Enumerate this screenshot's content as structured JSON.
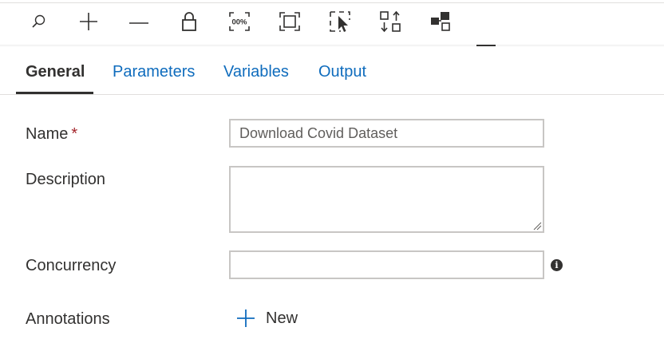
{
  "toolbar": {
    "tools": [
      {
        "icon": "search-icon"
      },
      {
        "icon": "plus-icon"
      },
      {
        "icon": "minus-icon"
      },
      {
        "icon": "lock-icon"
      },
      {
        "icon": "zoom-100-icon",
        "text": "00%"
      },
      {
        "icon": "fit-to-screen-icon"
      },
      {
        "icon": "select-icon"
      },
      {
        "icon": "auto-align-icon"
      },
      {
        "icon": "layout-icon"
      }
    ]
  },
  "tabs": [
    {
      "label": "General",
      "active": true
    },
    {
      "label": "Parameters",
      "active": false
    },
    {
      "label": "Variables",
      "active": false
    },
    {
      "label": "Output",
      "active": false
    }
  ],
  "form": {
    "name": {
      "label": "Name",
      "required_mark": "*",
      "value": "Download Covid Dataset"
    },
    "description": {
      "label": "Description",
      "value": ""
    },
    "concurrency": {
      "label": "Concurrency",
      "value": "",
      "info_icon": "i"
    },
    "annotations": {
      "label": "Annotations",
      "new_label": "New"
    }
  },
  "colors": {
    "link": "#0f6cbd",
    "text": "#323130",
    "required": "#a4262c",
    "border": "#c8c6c4"
  }
}
